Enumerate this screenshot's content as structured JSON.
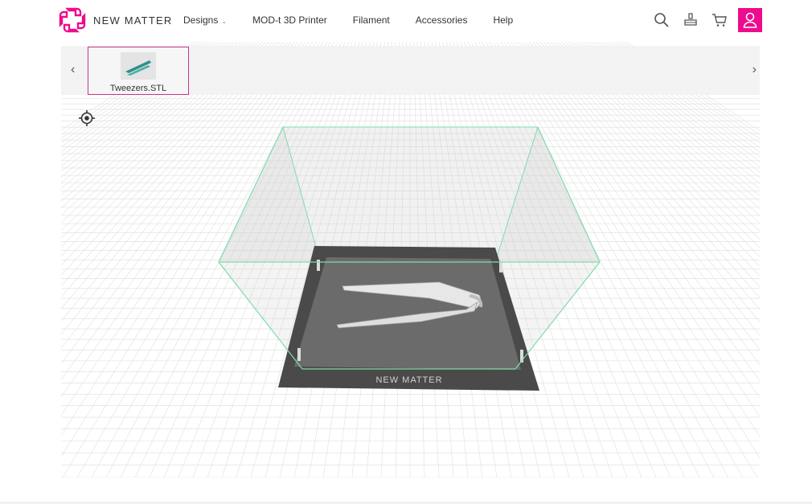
{
  "brand": {
    "name": "NEW MATTER",
    "accent_color": "#ec0c8d"
  },
  "nav": {
    "items": [
      {
        "label": "Designs",
        "has_dropdown": true
      },
      {
        "label": "MOD-t 3D Printer"
      },
      {
        "label": "Filament"
      },
      {
        "label": "Accessories"
      },
      {
        "label": "Help"
      }
    ]
  },
  "header_icons": [
    "search-icon",
    "printer-icon",
    "cart-icon",
    "user-icon"
  ],
  "tray": {
    "prev_arrow": "‹",
    "next_arrow": "›",
    "files": [
      {
        "name": "Tweezers.STL",
        "selected": true
      }
    ]
  },
  "viewer": {
    "bed_label": "NEW MATTER",
    "locate_icon": "crosshair-icon",
    "model": "tweezers"
  }
}
